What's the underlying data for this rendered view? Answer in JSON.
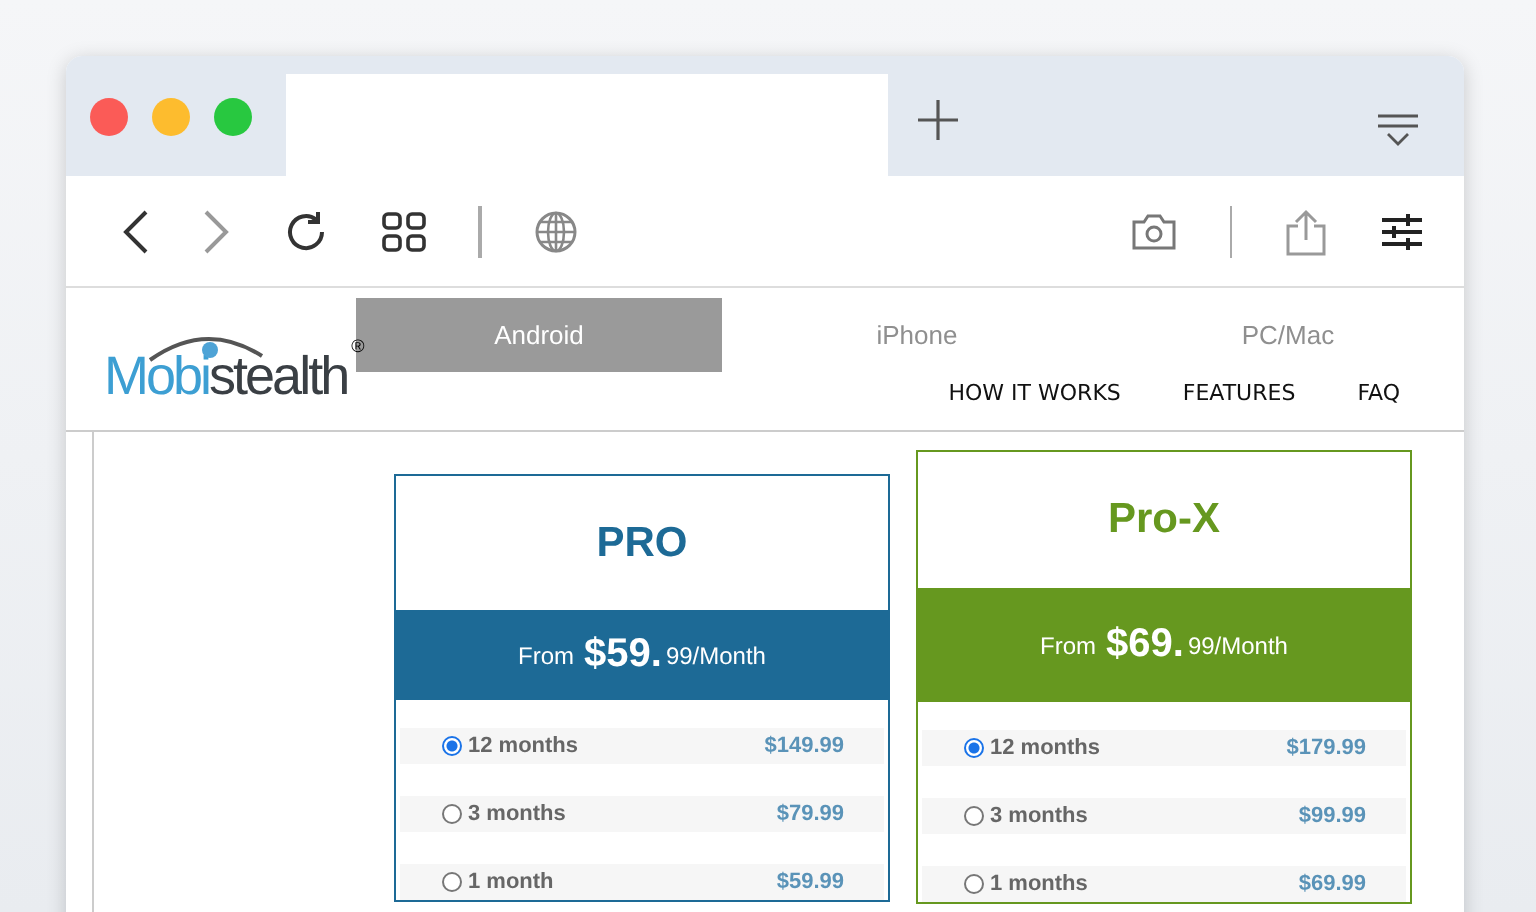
{
  "platform_tabs": [
    {
      "label": "Android",
      "selected": true
    },
    {
      "label": "iPhone",
      "selected": false
    },
    {
      "label": "PC/Mac",
      "selected": false
    }
  ],
  "logo": {
    "parts": [
      {
        "text": "Mobi",
        "color": "#3d9fd3"
      },
      {
        "text": "stealth",
        "color": "#3a3f44"
      }
    ],
    "mark": "®"
  },
  "nav": [
    "HOW IT WORKS",
    "FEATURES",
    "FAQ"
  ],
  "plans": [
    {
      "name": "PRO",
      "color": "#1d6a96",
      "featured": false,
      "price_prefix": "From",
      "price_main": "$59.",
      "price_suffix": "99/Month",
      "options": [
        {
          "label": "12 months",
          "price": "$149.99",
          "selected": true
        },
        {
          "label": "3 months",
          "price": "$79.99",
          "selected": false
        },
        {
          "label": "1 month",
          "price": "$59.99",
          "selected": false
        }
      ]
    },
    {
      "name": "Pro-X",
      "color": "#66981f",
      "featured": true,
      "price_prefix": "From",
      "price_main": "$69.",
      "price_suffix": "99/Month",
      "options": [
        {
          "label": "12 months",
          "price": "$179.99",
          "selected": true
        },
        {
          "label": "3 months",
          "price": "$99.99",
          "selected": false
        },
        {
          "label": "1 months",
          "price": "$69.99",
          "selected": false
        }
      ]
    }
  ]
}
